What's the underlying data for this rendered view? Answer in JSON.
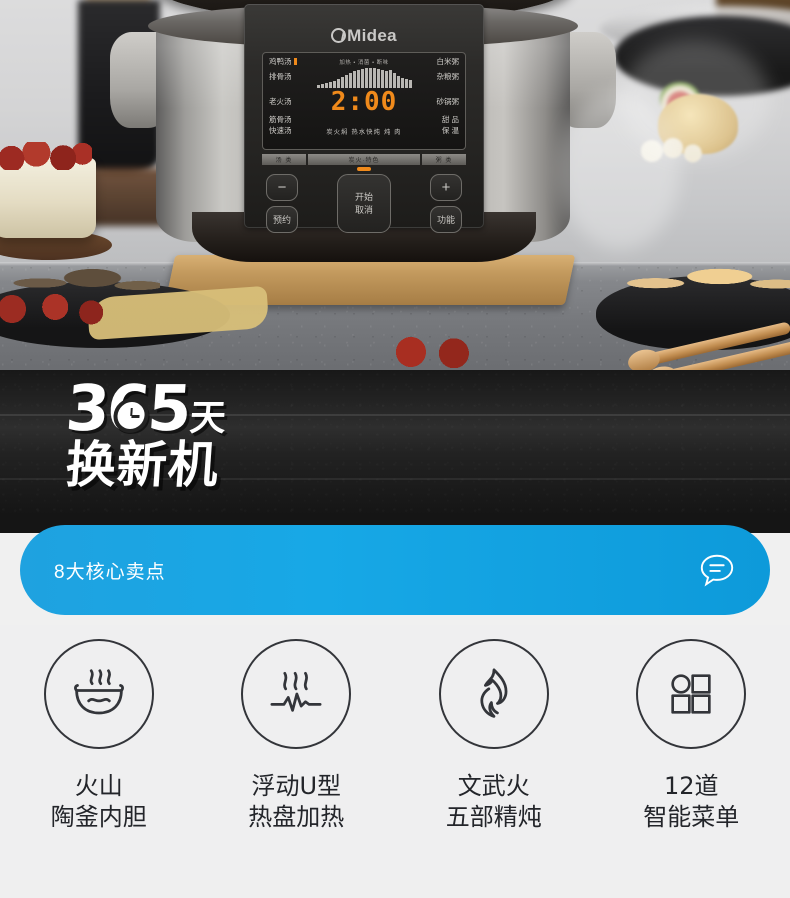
{
  "hero": {
    "alt": "midea-electric-stew-pot-kitchen-scene",
    "brand": "Midea",
    "display": {
      "left_menu": [
        "鸡鸭汤",
        "排骨汤",
        "老火汤",
        "筋骨汤",
        "快速汤"
      ],
      "right_menu": [
        "白米粥",
        "杂粮粥",
        "砂锅粥",
        "甜 品",
        "保 温"
      ],
      "top_status": [
        "加热",
        "消菌",
        "断味"
      ],
      "bottom_modes": [
        "炭火焖",
        "热水快炖",
        "炖",
        "肉"
      ],
      "timer": "2:00",
      "category_bar": [
        "汤 类",
        "炭火·特色",
        "粥 类"
      ]
    },
    "buttons": {
      "minus": "−",
      "plus": "+",
      "reserve": "预约",
      "function": "功能",
      "start_line1": "开始",
      "start_line2": "取消"
    }
  },
  "promo": {
    "number": "365",
    "day_unit": "天",
    "line2": "换新机"
  },
  "banner": {
    "title": "8大核心卖点",
    "icon": "chat-bubble-icon",
    "color_start": "#1fa2e0",
    "color_end": "#0d9ada"
  },
  "features": [
    {
      "icon": "steaming-bowl-icon",
      "line1": "火山",
      "line2": "陶釜内胆"
    },
    {
      "icon": "heating-plate-icon",
      "line1": "浮动U型",
      "line2": "热盘加热"
    },
    {
      "icon": "flame-icon",
      "line1": "文武火",
      "line2": "五部精炖"
    },
    {
      "icon": "menu-grid-icon",
      "line1": "12道",
      "line2": "智能菜单"
    }
  ]
}
